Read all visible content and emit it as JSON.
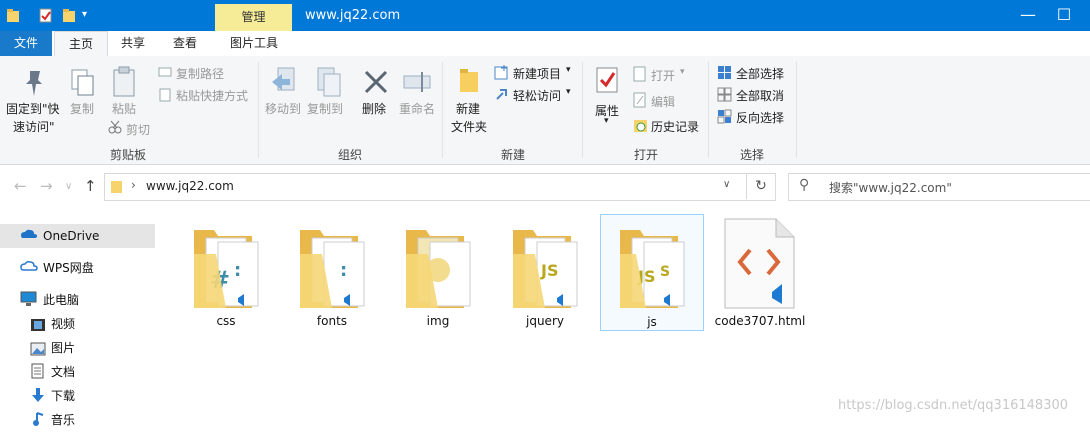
{
  "window": {
    "title": "www.jq22.com",
    "contextual_tab": "管理",
    "accent": "#0078d7",
    "controls": [
      "minimize-icon",
      "maximize-icon",
      "close-icon"
    ]
  },
  "tabs": [
    {
      "label": "文件"
    },
    {
      "label": "主页"
    },
    {
      "label": "共享"
    },
    {
      "label": "查看"
    },
    {
      "label": "图片工具"
    }
  ],
  "ribbon": {
    "clipboard": {
      "group_label": "剪贴板",
      "pin_line1": "固定到\"快",
      "pin_line2": "速访问\"",
      "copy": "复制",
      "paste": "粘贴",
      "copy_path": "复制路径",
      "paste_shortcut": "粘贴快捷方式",
      "cut": "剪切"
    },
    "organize": {
      "group_label": "组织",
      "move_to": "移动到",
      "copy_to": "复制到",
      "delete": "删除",
      "rename": "重命名"
    },
    "new": {
      "group_label": "新建",
      "new_folder_line1": "新建",
      "new_folder_line2": "文件夹",
      "new_item": "新建项目",
      "easy_access": "轻松访问"
    },
    "open": {
      "group_label": "打开",
      "properties": "属性",
      "open": "打开",
      "edit": "编辑",
      "history": "历史记录"
    },
    "select": {
      "group_label": "选择",
      "select_all": "全部选择",
      "select_none": "全部取消",
      "invert": "反向选择"
    }
  },
  "address": {
    "path": "www.jq22.com",
    "search_placeholder": "搜索\"www.jq22.com\""
  },
  "nav": [
    {
      "label": "OneDrive",
      "icon": "cloud-icon"
    },
    {
      "label": "WPS网盘",
      "icon": "wps-cloud-icon"
    },
    {
      "label": "此电脑",
      "icon": "computer-icon"
    },
    {
      "label": "视频",
      "icon": "video-icon"
    },
    {
      "label": "图片",
      "icon": "picture-icon"
    },
    {
      "label": "文档",
      "icon": "document-icon"
    },
    {
      "label": "下载",
      "icon": "download-icon"
    },
    {
      "label": "音乐",
      "icon": "music-icon"
    }
  ],
  "files": [
    {
      "name": "css",
      "type": "folder",
      "badge": "#"
    },
    {
      "name": "fonts",
      "type": "folder",
      "badge": ""
    },
    {
      "name": "img",
      "type": "folder",
      "badge": ""
    },
    {
      "name": "jquery",
      "type": "folder",
      "badge": "JS"
    },
    {
      "name": "js",
      "type": "folder",
      "badge": "JS"
    },
    {
      "name": "code3707.html",
      "type": "file",
      "badge": ""
    }
  ],
  "watermark": "https://blog.csdn.net/qq316148300"
}
